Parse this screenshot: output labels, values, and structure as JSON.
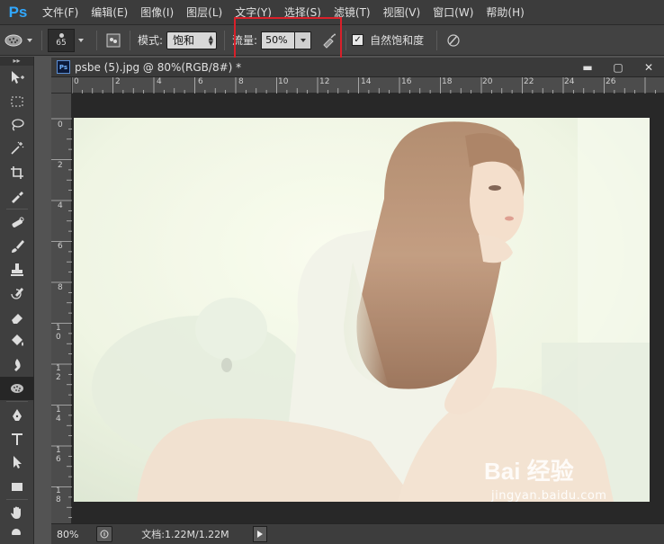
{
  "app": {
    "logo": "Ps"
  },
  "menu": [
    "文件(F)",
    "编辑(E)",
    "图像(I)",
    "图层(L)",
    "文字(Y)",
    "选择(S)",
    "滤镜(T)",
    "视图(V)",
    "窗口(W)",
    "帮助(H)"
  ],
  "options": {
    "brush_size": "65",
    "mode_label": "模式:",
    "mode_value": "饱和",
    "flow_label": "流量:",
    "flow_value": "50%",
    "vibrance_label": "自然饱和度",
    "vibrance_checked": true
  },
  "document": {
    "icon": "Ps",
    "title": "psbe (5).jpg @ 80%(RGB/8#) *",
    "controls": {
      "minimize": "▬",
      "restore": "▢",
      "close": "✕"
    }
  },
  "ruler": {
    "h_labels": [
      "0",
      "2",
      "4",
      "6",
      "8",
      "10",
      "12",
      "14",
      "16",
      "18",
      "20",
      "22",
      "24",
      "26"
    ],
    "v_labels": [
      "0",
      "2",
      "4",
      "6",
      "8",
      "10",
      "12",
      "14",
      "16",
      "18"
    ]
  },
  "status": {
    "zoom": "80%",
    "doc_info": "文档:1.22M/1.22M"
  },
  "watermark": {
    "brand": "Bai 经验",
    "url": "jingyan.baidu.com"
  },
  "colors": {
    "highlight": "#d9202a",
    "ps_blue": "#31a8ff"
  },
  "tools": [
    "move-tool",
    "marquee-tool",
    "lasso-tool",
    "magic-wand-tool",
    "crop-tool",
    "eyedropper-tool",
    "healing-brush-tool",
    "brush-tool",
    "clone-stamp-tool",
    "history-brush-tool",
    "eraser-tool",
    "gradient-tool",
    "blur-tool",
    "sponge-tool",
    "pen-tool",
    "type-tool",
    "path-select-tool",
    "rectangle-tool",
    "hand-tool"
  ]
}
